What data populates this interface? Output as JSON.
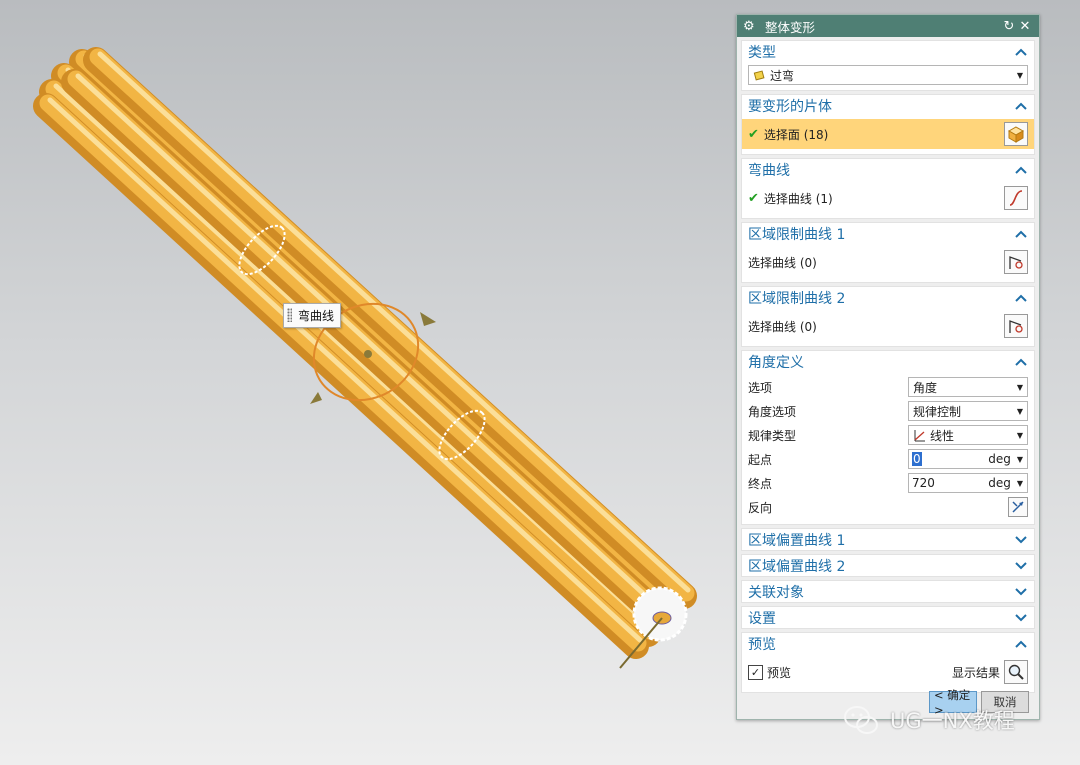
{
  "viewport": {
    "tooltip": "弯曲线",
    "colors": {
      "rod": "#f2b544",
      "rod_light": "#fde7a8",
      "rod_dark": "#d08c25",
      "curve": "#e0882a"
    }
  },
  "dialog": {
    "title": "整体变形",
    "sections": {
      "type": {
        "header": "类型",
        "value": "过弯"
      },
      "body": {
        "header": "要变形的片体",
        "select": "选择面 (18)"
      },
      "bend_curve": {
        "header": "弯曲线",
        "select": "选择曲线 (1)"
      },
      "region1": {
        "header": "区域限制曲线 1",
        "select": "选择曲线 (0)"
      },
      "region2": {
        "header": "区域限制曲线 2",
        "select": "选择曲线 (0)"
      },
      "angle": {
        "header": "角度定义",
        "option_label": "选项",
        "option_value": "角度",
        "angle_option_label": "角度选项",
        "angle_option_value": "规律控制",
        "law_type_label": "规律类型",
        "law_type_value": "线性",
        "start_label": "起点",
        "start_value": "0",
        "start_unit": "deg",
        "end_label": "终点",
        "end_value": "720",
        "end_unit": "deg",
        "reverse_label": "反向"
      },
      "offset1": {
        "header": "区域偏置曲线 1"
      },
      "offset2": {
        "header": "区域偏置曲线 2"
      },
      "assoc": {
        "header": "关联对象"
      },
      "settings": {
        "header": "设置"
      },
      "preview": {
        "header": "预览",
        "checkbox_label": "预览",
        "show_result": "显示结果"
      }
    },
    "ok": "< 确定 >",
    "cancel": "取消",
    "colors": {
      "title_bg": "#4f7f74",
      "header_text": "#1f6fa8",
      "selected_row": "#ffd57b",
      "ok_bg": "#a8d1f0"
    }
  },
  "watermark": "UG一NX教程"
}
